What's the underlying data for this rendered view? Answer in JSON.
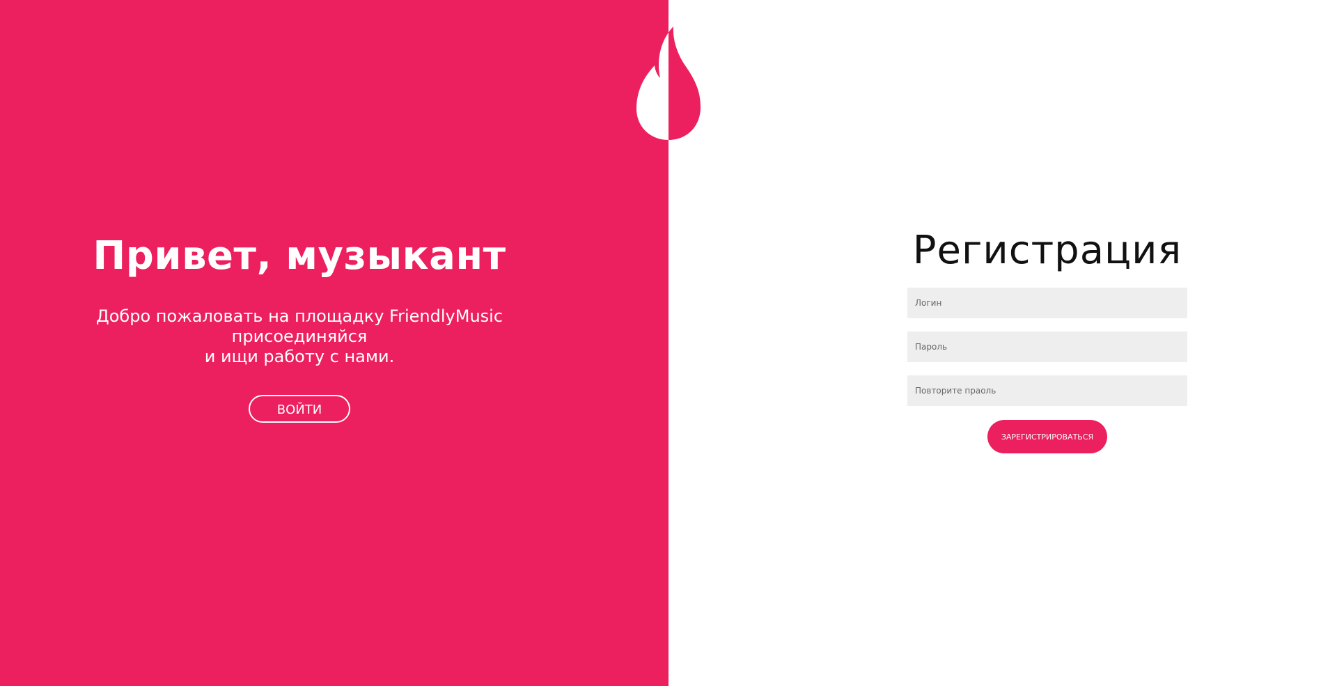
{
  "colors": {
    "accent": "#ec205e",
    "background": "#ffffff",
    "field_background": "#eeeeee"
  },
  "logo": {
    "icon": "flame-icon"
  },
  "welcome": {
    "title": "Привет, музыкант",
    "lines": [
      "Добро пожаловать на площадку FriendlyMusic",
      "присоединяйся",
      "и ищи работу с нами."
    ],
    "login_label": "ВОЙТИ"
  },
  "register": {
    "title": "Регистрация",
    "login_placeholder": "Логин",
    "password_placeholder": "Пароль",
    "repeat_password_placeholder": "Повторите праоль",
    "submit_label": "ЗАРЕГИСТРИРОВАТЬСЯ"
  }
}
